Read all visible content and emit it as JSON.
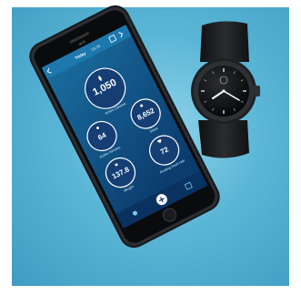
{
  "phone": {
    "status_time": "09:25",
    "header": {
      "title": "Today",
      "date": "03.29"
    },
    "metrics": [
      {
        "value": "1,050",
        "label": "Active Calories"
      },
      {
        "value": "64",
        "label": "Active minutes"
      },
      {
        "value": "8,652",
        "label": "Steps"
      },
      {
        "value": "72",
        "label": "Resting heart rate"
      },
      {
        "value": "137.8",
        "label": "Weight"
      }
    ],
    "colors": {
      "screen_top": "#1a6fa0",
      "screen_bottom": "#0c3b6e",
      "bubble": "#143e74",
      "ring": "#ffffff"
    },
    "icons": [
      "back-icon",
      "calendar-icon",
      "share-icon",
      "flame-icon",
      "activity-icon",
      "footsteps-icon",
      "heart-icon",
      "scale-icon",
      "profile-icon",
      "add-icon",
      "grid-icon"
    ]
  },
  "watch": {
    "colors": {
      "case": "#1b1d20",
      "strap": "#151618",
      "dial": "#0d0e10"
    }
  }
}
